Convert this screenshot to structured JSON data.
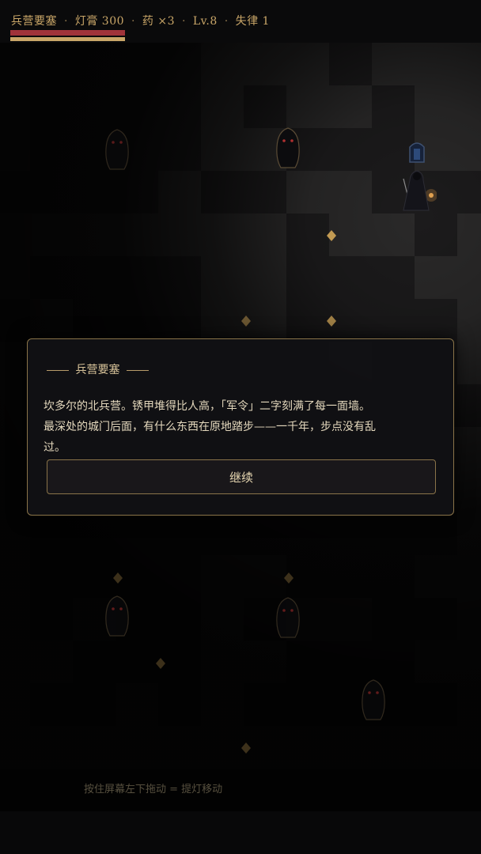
{
  "hud": {
    "area_name": "兵营要塞",
    "lamp_oil": "灯膏 300",
    "potions": "药 ×3",
    "level": "Lv.8",
    "discipline": "失律 1",
    "separator": "·",
    "hp_fraction": 1.0,
    "oil_fraction": 1.0,
    "colors": {
      "hp": "#a0333a",
      "oil": "#c9a668",
      "hud_text": "#c9a668"
    }
  },
  "map": {
    "player_icon": "hooded-lantern-bearer",
    "door_icon": "shrine-door",
    "enemy_icon": "shadow-specter-red-eyes",
    "pickup_icon": "amber-shard"
  },
  "dialog": {
    "title": "兵营要塞",
    "body_lines": [
      "坎多尔的北兵营。锈甲堆得比人高，「军令」二字刻满了每一面墙。",
      "最深处的城门后面，有什么东西在原地踏步——一千年，步点没有乱",
      "过。"
    ],
    "continue_label": "继续"
  },
  "hint": "按住屏幕左下拖动 = 提灯移动"
}
